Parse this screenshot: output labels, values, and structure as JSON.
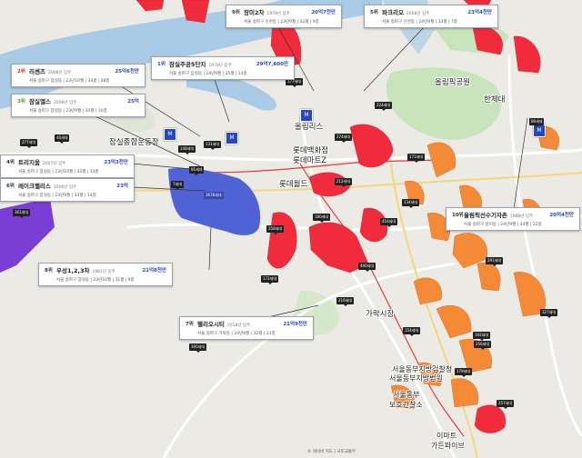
{
  "map": {
    "places": {
      "olympic_park": "올림픽공원",
      "hanchae": "한체대",
      "jamsil_sports": "잠실종합운동장",
      "lotte_dept": "롯데백화점",
      "lotte_mart": "롯데마트Z",
      "olympics_tower": "올림리스",
      "lotte_world": "롯데월드",
      "garak_market": "가락시장",
      "east_court": "서울동부지방검찰청",
      "east_court2": "서울동부지방법원",
      "east_probation": "서울동부",
      "east_probation2": "보호관찰소",
      "emart": "이마트",
      "garden_five": "가든파이브"
    },
    "footer": "© 네이버 지도 | 국토교통부"
  },
  "cards": [
    {
      "rank": "1위",
      "name": "잠실주공5단지",
      "year": "1978년 입주",
      "price": "29억7,600만",
      "detail": "서울 송파구 잠실동 | 24년9월 | 35평 | 14층",
      "color": "blue"
    },
    {
      "rank": "2위",
      "name": "리센츠",
      "year": "2008년 입주",
      "price": "25억6천만",
      "detail": "서울 송파구 잠실동 | 23년10월 | 33평 | 28층",
      "color": "red"
    },
    {
      "rank": "3위",
      "name": "잠실엘스",
      "year": "2008년 입주",
      "price": "25억",
      "detail": "서울 송파구 잠실동 | 23년9월 | 33평 | 10층",
      "color": "green"
    },
    {
      "rank": "4위",
      "name": "트리지움",
      "year": "2007년 입주",
      "price": "23억3천만",
      "detail": "서울 송파구 잠실동 | 23년10월 | 33평 | 13층",
      "color": "dark"
    },
    {
      "rank": "5위",
      "name": "파크리오",
      "year": "2008년 입주",
      "price": "23억4천만",
      "detail": "서울 송파구 신천동 | 24년9월 | 33평 | 7층",
      "color": "dark"
    },
    {
      "rank": "6위",
      "name": "레이크팰리스",
      "year": "2006년 입주",
      "price": "23억",
      "detail": "서울 송파구 잠실동 | 23년9월 | 33평 | 14층",
      "color": "dark"
    },
    {
      "rank": "7위",
      "name": "헬리오시티",
      "year": "2018년 입주",
      "price": "21억9천만",
      "detail": "서울 송파구 가락동 | 24년9월 | 32평 | 21층",
      "color": "dark"
    },
    {
      "rank": "8위",
      "name": "우성1,2,3차",
      "year": "1981년 입주",
      "price": "21억8천만",
      "detail": "서울 송파구 잠실동 | 23년10월 | 31평 | 9층",
      "color": "dark"
    },
    {
      "rank": "9위",
      "name": "장미2차",
      "year": "1979년 입주",
      "price": "20억7천만",
      "detail": "서울 송파구 신천동 | 23년9월 | 32평 | 9층",
      "color": "dark"
    },
    {
      "rank": "10위",
      "name": "올림픽선수기자촌",
      "year": "1988년 입주",
      "price": "20억4천만",
      "detail": "서울 송파구 방이동 | 24년9월 | 34평 | 22층",
      "color": "dark"
    }
  ],
  "tags": [
    "177세대",
    "277세대",
    "361세대",
    "40세대",
    "148세대",
    "131세대",
    "95세대",
    "3678세대",
    "7세대",
    "258세대",
    "180세대",
    "212세대",
    "274세대",
    "224세대",
    "416세대",
    "400세대",
    "172세대",
    "134세대",
    "216세대",
    "138세대",
    "291세대",
    "171세대",
    "89세대",
    "327세대",
    "154세대",
    "192세대",
    "256세대",
    "179세대",
    "257세대",
    "300세대"
  ],
  "colors": {
    "water": "#a9cbe6",
    "park": "#c8e4bd",
    "red": "#f02b3c",
    "orange": "#f58a36",
    "blue": "#4f63d6",
    "purple": "#7a3ed4"
  }
}
